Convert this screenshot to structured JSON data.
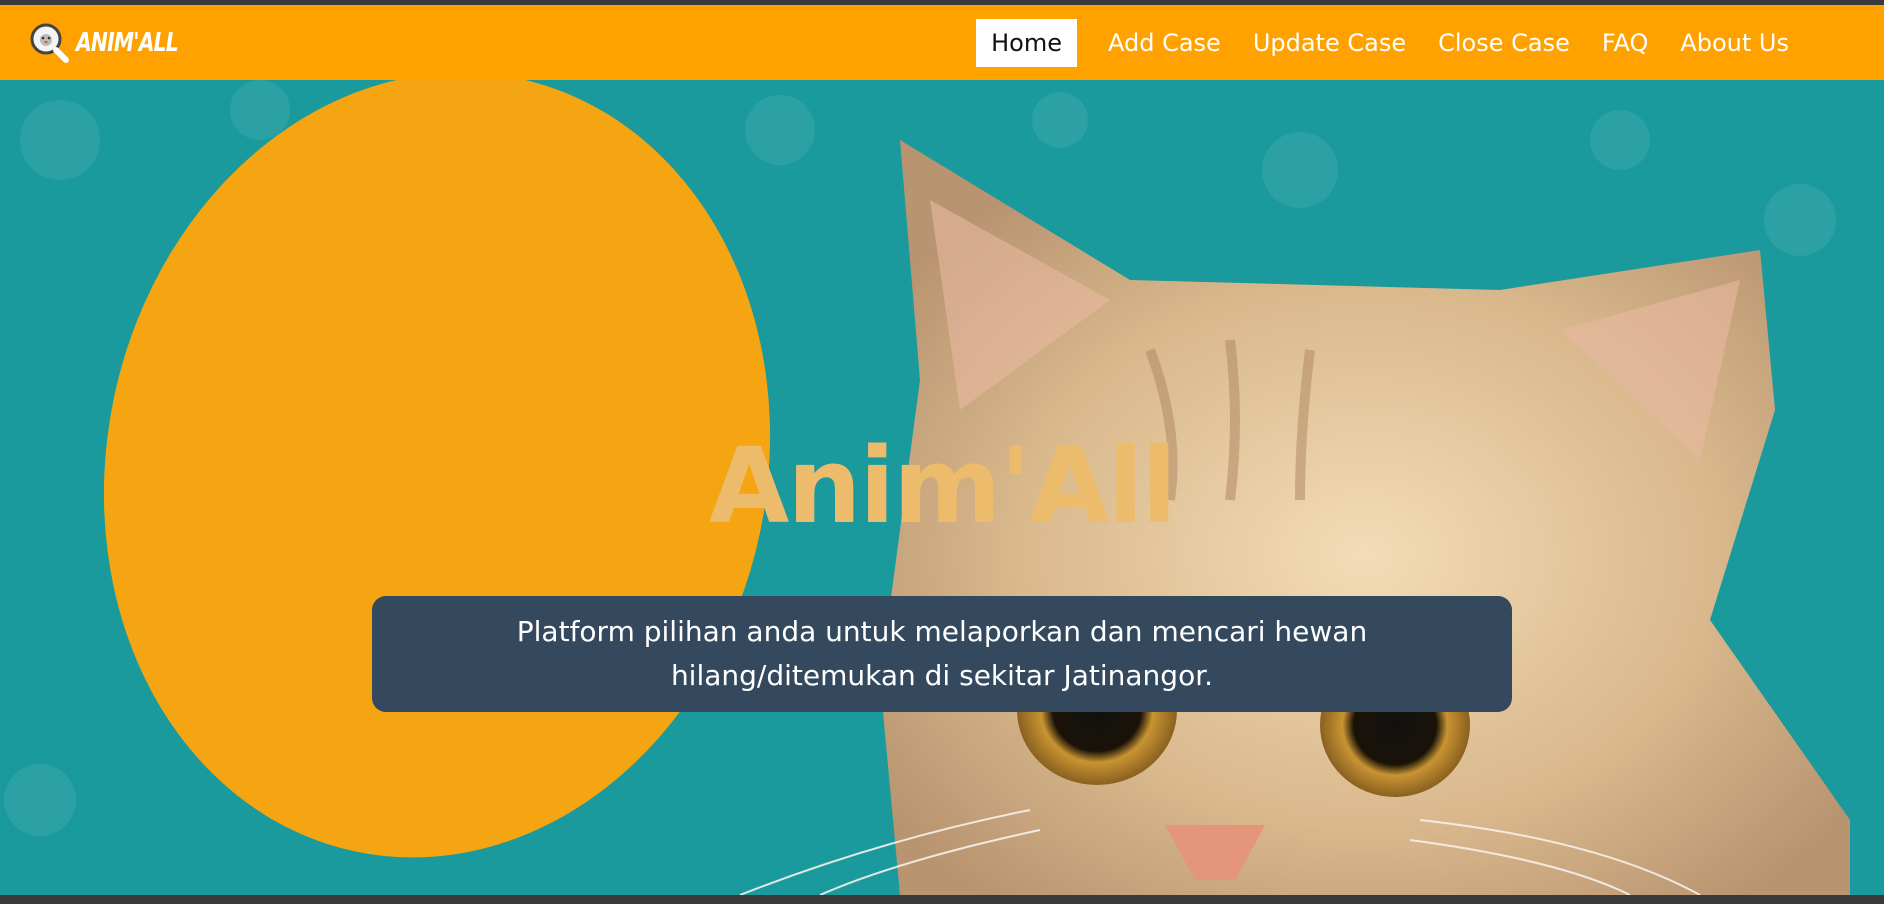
{
  "brand": {
    "logo_text": "ANIM'ALL"
  },
  "nav": {
    "items": [
      {
        "label": "Home",
        "active": true
      },
      {
        "label": "Add Case",
        "active": false
      },
      {
        "label": "Update Case",
        "active": false
      },
      {
        "label": "Close Case",
        "active": false
      },
      {
        "label": "FAQ",
        "active": false
      },
      {
        "label": "About Us",
        "active": false
      }
    ]
  },
  "hero": {
    "title": "Anim'All",
    "caption": "Platform pilihan anda untuk melaporkan dan mencari hewan hilang/ditemukan di sekitar Jatinangor.",
    "image": "kitten-on-teal-background-with-orange-circle"
  },
  "colors": {
    "navbar": "#ffa200",
    "hero_bg": "#1a9a9c",
    "title": "#ecbc6c",
    "caption_bg": "#34495e"
  }
}
